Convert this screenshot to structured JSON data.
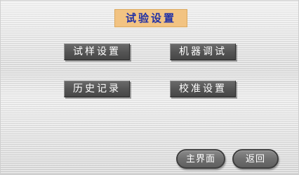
{
  "header": {
    "title": "试验设置"
  },
  "menu": {
    "sample_settings": "试样设置",
    "machine_debug": "机器调试",
    "history": "历史记录",
    "calibration": "校准设置"
  },
  "footer": {
    "main_screen": "主界面",
    "back": "返回"
  },
  "colors": {
    "title_bg": "#f2c382",
    "title_text": "#1f2fa6",
    "button_bg": "#555555",
    "button_text": "#ffffff",
    "pill_bg": "#707070"
  }
}
